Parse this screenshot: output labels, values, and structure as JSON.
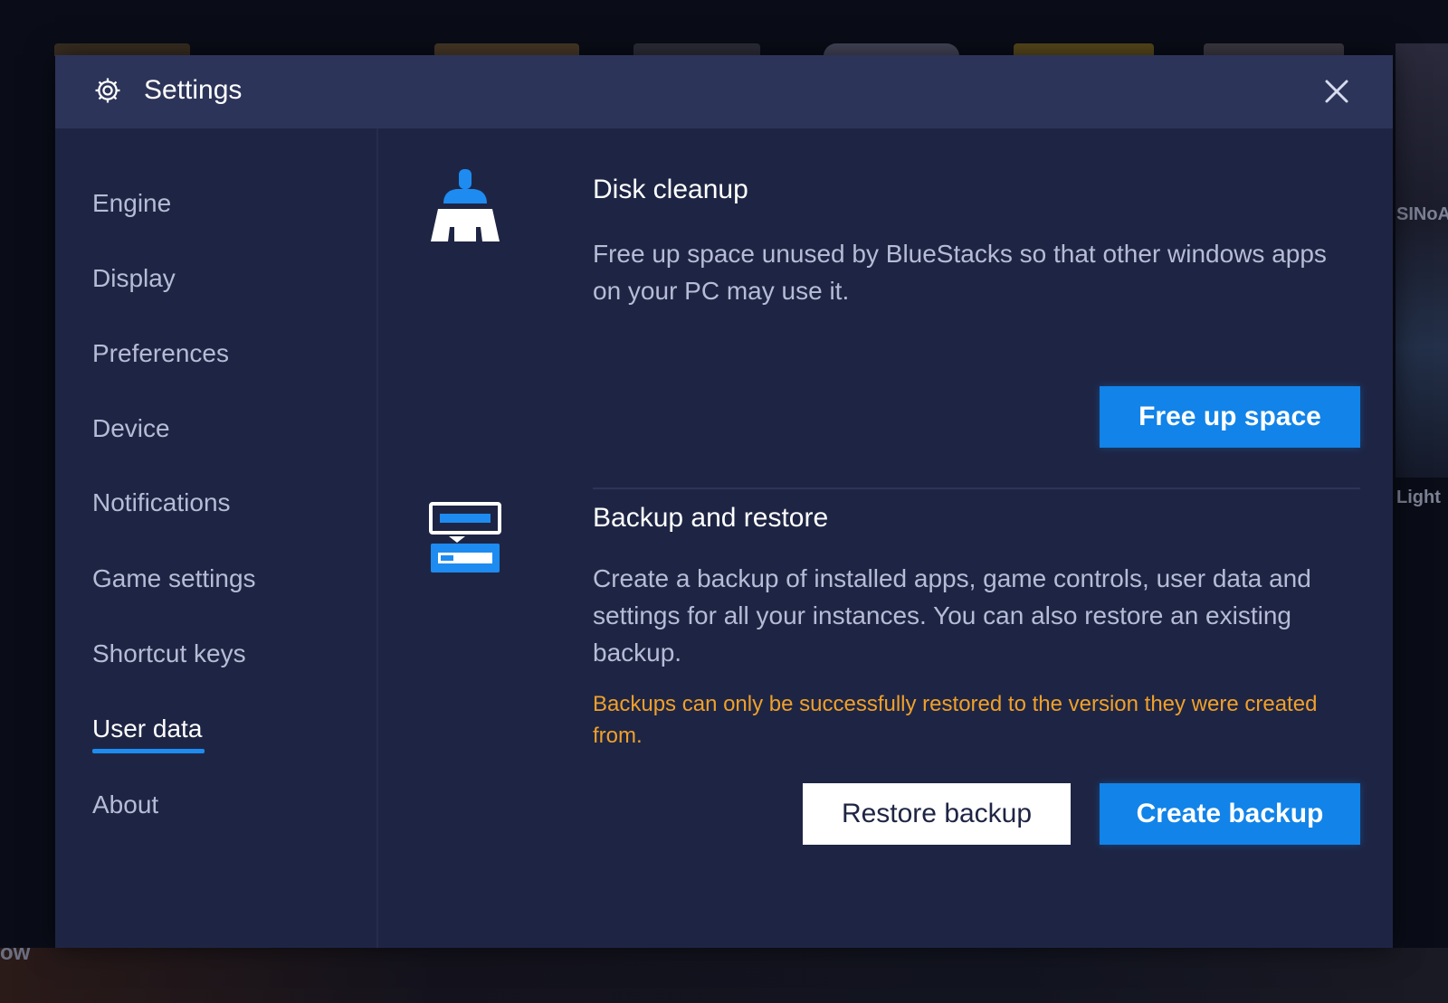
{
  "window": {
    "title": "Settings",
    "close_icon": "close-icon",
    "gear_icon": "gear-icon"
  },
  "background": {
    "side_labels": [
      "SINoA",
      "Light"
    ],
    "bottom_label": "ow"
  },
  "sidebar": {
    "items": [
      {
        "label": "Engine"
      },
      {
        "label": "Display"
      },
      {
        "label": "Preferences"
      },
      {
        "label": "Device"
      },
      {
        "label": "Notifications"
      },
      {
        "label": "Game settings"
      },
      {
        "label": "Shortcut keys"
      },
      {
        "label": "User data",
        "active": true
      },
      {
        "label": "About"
      }
    ]
  },
  "disk_cleanup": {
    "icon": "broom-icon",
    "title": "Disk cleanup",
    "description": "Free up space unused by BlueStacks so that other windows apps on your PC may use it.",
    "button_label": "Free up space"
  },
  "backup_restore": {
    "icon": "backup-drive-icon",
    "title": "Backup and restore",
    "description": "Create a backup of installed apps, game controls, user data and settings for all your instances. You can also restore an existing backup.",
    "warning": "Backups can only be successfully restored to the version they were created from.",
    "restore_label": "Restore backup",
    "create_label": "Create backup"
  },
  "colors": {
    "accent": "#1283e8",
    "panel": "#1e2544",
    "titlebar": "#2c3459",
    "warning": "#f0a02a"
  }
}
